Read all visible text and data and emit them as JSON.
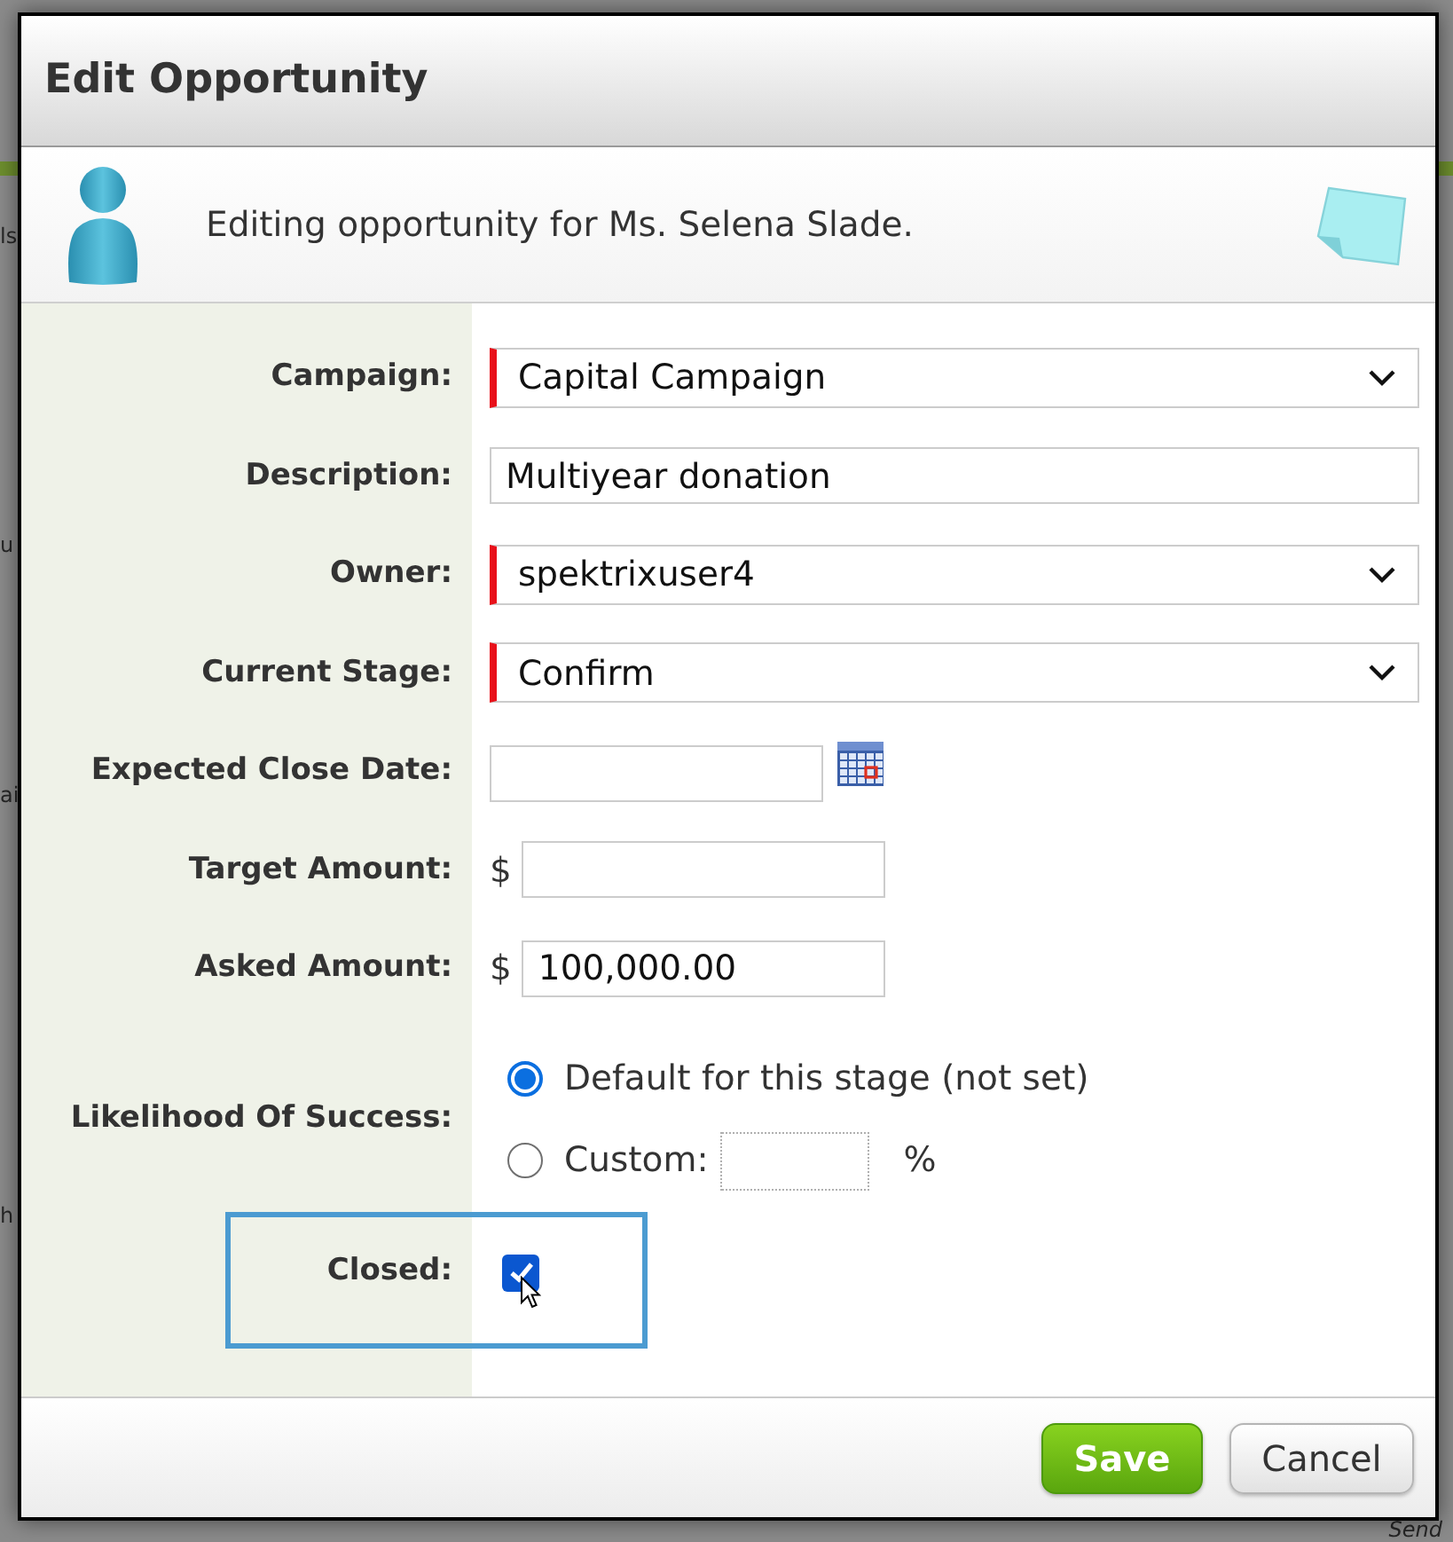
{
  "dialog": {
    "title": "Edit Opportunity",
    "intro": "Editing opportunity for Ms. Selena Slade."
  },
  "fields": [
    {
      "kind": "select",
      "label": "Campaign:",
      "value": "Capital Campaign",
      "required": true
    },
    {
      "kind": "text",
      "label": "Description:",
      "value": "Multiyear donation",
      "required": false
    },
    {
      "kind": "select",
      "label": "Owner:",
      "value": "spektrixuser4",
      "required": true
    },
    {
      "kind": "select",
      "label": "Current Stage:",
      "value": "Confirm",
      "required": true
    },
    {
      "kind": "date",
      "label": "Expected Close Date:",
      "required": false
    },
    {
      "kind": "currency",
      "label": "Target Amount:",
      "prefix": "$",
      "required": false
    },
    {
      "kind": "currency",
      "label": "Asked Amount:",
      "prefix": "$",
      "value": "100,000.00",
      "required": false
    },
    {
      "kind": "radios",
      "label": "Likelihood Of Success:",
      "options": [
        {
          "label": "Default for this stage (not set)",
          "selected": true
        },
        {
          "label": "Custom:",
          "selected": false,
          "suffix": "%"
        }
      ]
    },
    {
      "kind": "checkbox",
      "label": "Closed:",
      "checked": true,
      "highlighted": true
    }
  ],
  "buttons": [
    {
      "label": "Save",
      "kind": "primary"
    },
    {
      "label": "Cancel",
      "kind": "secondary"
    }
  ],
  "background_page": {
    "left_fragments": [
      "ls",
      "u",
      "ai",
      "h"
    ],
    "right_fragments": [
      "Send"
    ]
  }
}
